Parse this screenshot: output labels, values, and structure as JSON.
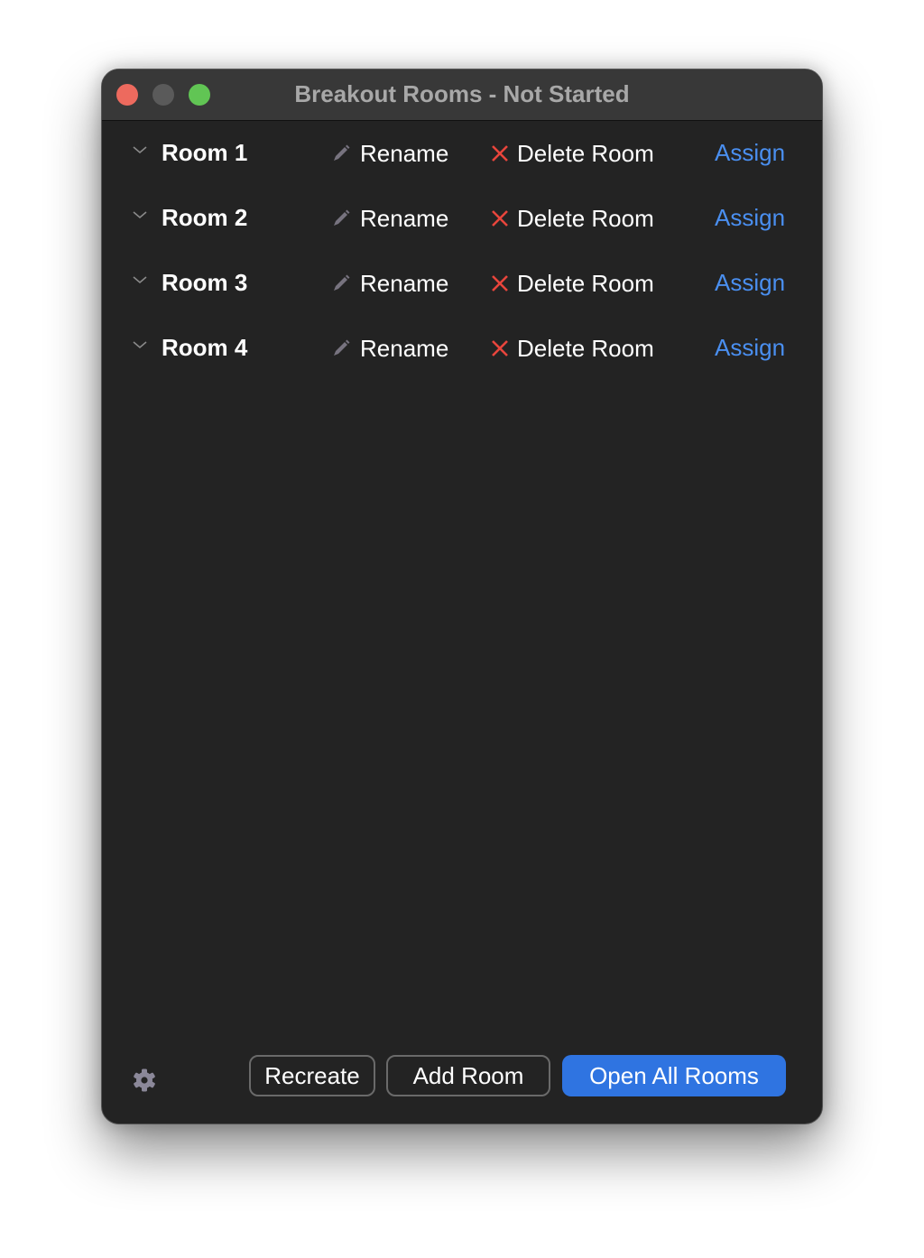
{
  "window": {
    "title": "Breakout Rooms - Not Started"
  },
  "rooms": [
    {
      "name": "Room 1",
      "rename_label": "Rename",
      "delete_label": "Delete Room",
      "assign_label": "Assign"
    },
    {
      "name": "Room 2",
      "rename_label": "Rename",
      "delete_label": "Delete Room",
      "assign_label": "Assign"
    },
    {
      "name": "Room 3",
      "rename_label": "Rename",
      "delete_label": "Delete Room",
      "assign_label": "Assign"
    },
    {
      "name": "Room 4",
      "rename_label": "Rename",
      "delete_label": "Delete Room",
      "assign_label": "Assign"
    }
  ],
  "footer": {
    "settings_icon": "gear-icon",
    "recreate_label": "Recreate",
    "add_room_label": "Add Room",
    "open_all_label": "Open All Rooms"
  },
  "colors": {
    "accent": "#2f74e1",
    "link": "#4a8ff0",
    "delete": "#e8453c",
    "background": "#232323"
  }
}
